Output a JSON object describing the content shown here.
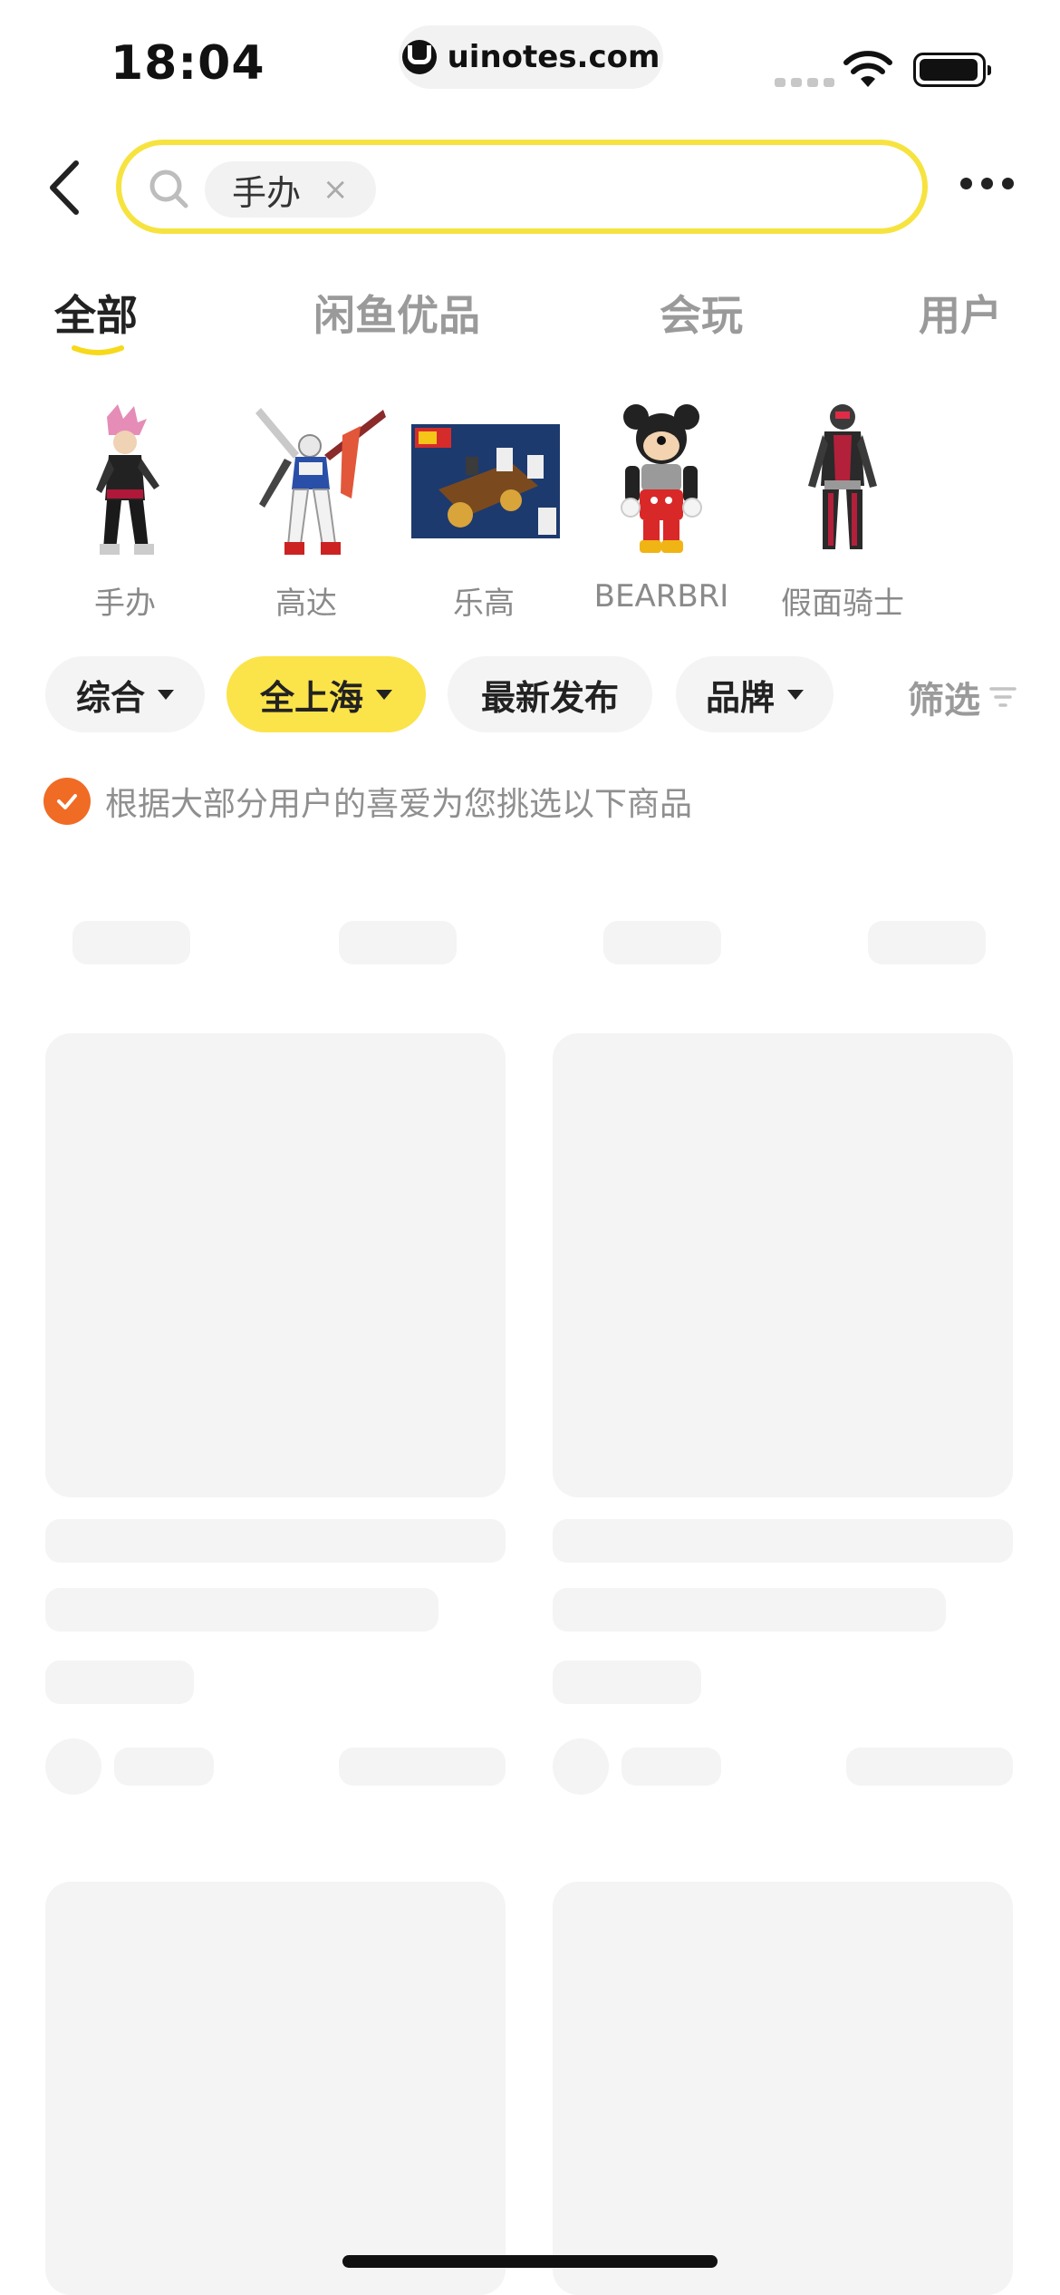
{
  "status_bar": {
    "time": "18:04",
    "url": "uinotes.com"
  },
  "search": {
    "query_chip": "手办",
    "clear_glyph": "×"
  },
  "tabs": [
    {
      "label": "全部",
      "active": true
    },
    {
      "label": "闲鱼优品",
      "active": false
    },
    {
      "label": "会玩",
      "active": false
    },
    {
      "label": "用户",
      "active": false
    }
  ],
  "categories": [
    {
      "label": "手办",
      "icon": "anime-figure-image"
    },
    {
      "label": "高达",
      "icon": "gundam-model-image"
    },
    {
      "label": "乐高",
      "icon": "lego-box-image"
    },
    {
      "label": "BEARBRI",
      "icon": "bearbrick-figure-image"
    },
    {
      "label": "假面骑士",
      "icon": "kamen-rider-figure-image"
    }
  ],
  "filters": {
    "sort": "综合",
    "location": "全上海",
    "newest": "最新发布",
    "brand": "品牌",
    "filter": "筛选"
  },
  "note": "根据大部分用户的喜爱为您挑选以下商品",
  "colors": {
    "accent_yellow": "#fbe34a",
    "search_border": "#f6e33f",
    "check_orange": "#f06b24",
    "skeleton": "#f4f4f4"
  }
}
